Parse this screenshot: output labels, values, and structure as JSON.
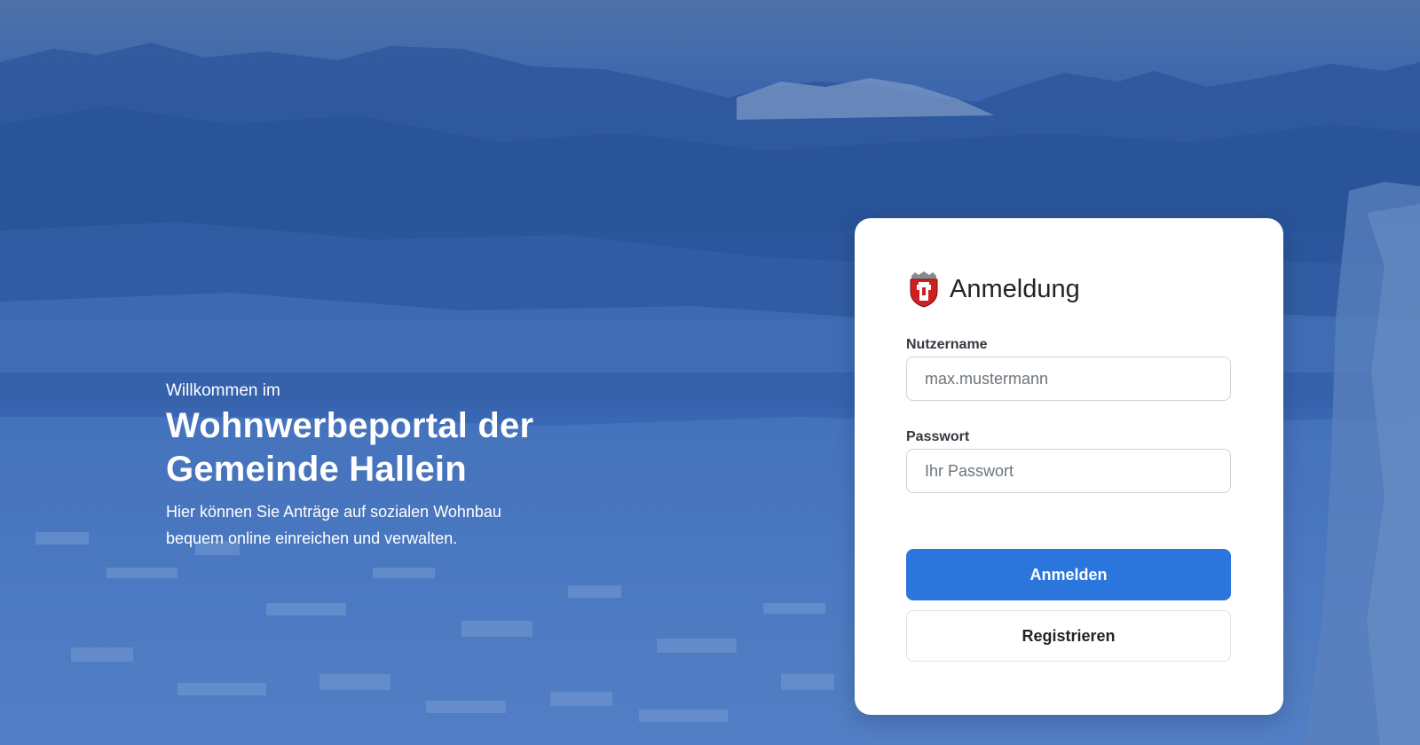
{
  "colors": {
    "accent": "#2a76dd",
    "overlay": "#3461ad",
    "card": "#ffffff"
  },
  "intro": {
    "welcome": "Willkommen im",
    "title_line1": "Wohnwerbeportal der",
    "title_line2": "Gemeinde Hallein",
    "text_line1": "Hier können Sie Anträge auf sozialen Wohnbau",
    "text_line2": "bequem online einreichen und verwalten."
  },
  "login": {
    "title": "Anmeldung",
    "icon": "hallein-crest-icon",
    "username_label": "Nutzername",
    "username_placeholder": "max.mustermann",
    "password_label": "Passwort",
    "password_placeholder": "Ihr Passwort",
    "submit_label": "Anmelden",
    "register_label": "Registrieren"
  }
}
